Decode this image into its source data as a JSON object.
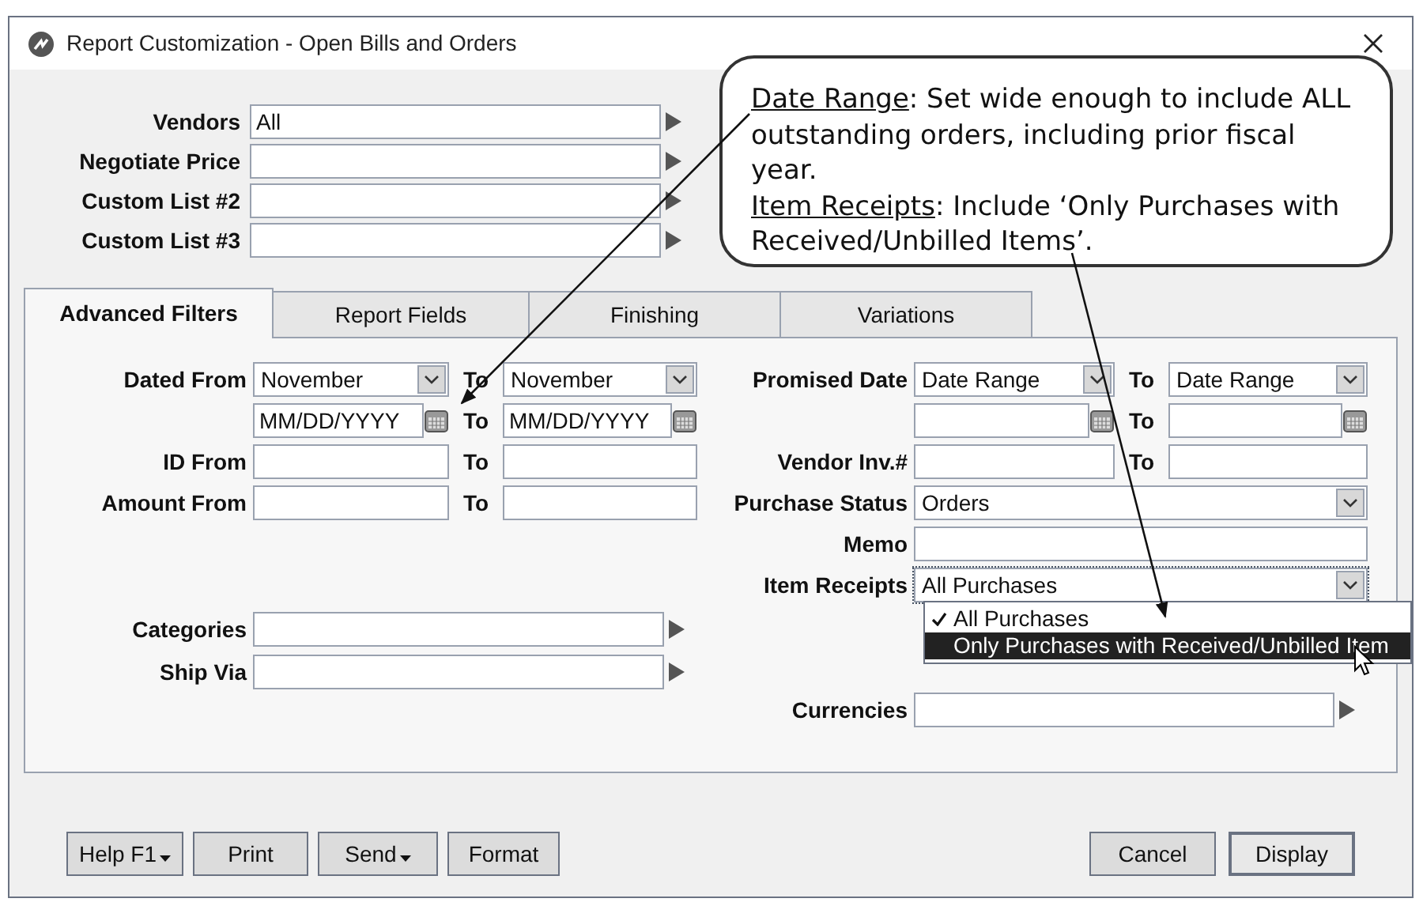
{
  "window": {
    "title": "Report Customization - Open Bills and Orders"
  },
  "top_fields": [
    {
      "label": "Vendors",
      "value": "All"
    },
    {
      "label": "Negotiate Price"
    },
    {
      "label": "Custom List #2"
    },
    {
      "label": "Custom List #3"
    }
  ],
  "tabs": [
    {
      "label": "Advanced Filters",
      "selected": true
    },
    {
      "label": "Report Fields",
      "selected": false
    },
    {
      "label": "Finishing",
      "selected": false
    },
    {
      "label": "Variations",
      "selected": false
    }
  ],
  "left_upper": [
    {
      "kind": "select_range",
      "label": "Dated From",
      "from": "November",
      "to_label": "To",
      "to": "November"
    },
    {
      "kind": "date_range",
      "from": "MM/DD/YYYY",
      "to_label": "To",
      "to": "MM/DD/YYYY"
    },
    {
      "kind": "text_range",
      "label": "ID From",
      "to_label": "To"
    },
    {
      "kind": "text_range",
      "label": "Amount From",
      "to_label": "To"
    }
  ],
  "left_lower": [
    {
      "kind": "list",
      "label": "Categories"
    },
    {
      "kind": "list",
      "label": "Ship Via"
    }
  ],
  "right_upper": [
    {
      "kind": "select_range",
      "label": "Promised Date",
      "from": "Date Range",
      "to_label": "To",
      "to": "Date Range"
    },
    {
      "kind": "date_range",
      "to_label": "To"
    },
    {
      "kind": "text_range",
      "label": "Vendor Inv.#",
      "to_label": "To"
    },
    {
      "kind": "select",
      "label": "Purchase Status",
      "value": "Orders"
    },
    {
      "kind": "text",
      "label": "Memo"
    },
    {
      "kind": "select",
      "label": "Item Receipts",
      "value": "All Purchases",
      "open": true
    }
  ],
  "right_lower": [
    {
      "kind": "list",
      "label": "Currencies"
    }
  ],
  "item_receipts_options": [
    {
      "label": "All Purchases",
      "checked": true,
      "selected": false
    },
    {
      "label": "Only Purchases with Received/Unbilled Item",
      "checked": false,
      "selected": true
    }
  ],
  "callout": [
    {
      "term": "Date Range",
      "text": ": Set wide enough to include ALL outstanding orders, including prior fiscal year."
    },
    {
      "term": "Item Receipts",
      "text": ": Include ‘Only Purchases with Received/Unbilled Items’."
    }
  ],
  "buttons_left": [
    {
      "label": "Help F1",
      "caret": true
    },
    {
      "label": "Print",
      "caret": false
    },
    {
      "label": "Send",
      "caret": true
    },
    {
      "label": "Format",
      "caret": false
    }
  ],
  "buttons_right": [
    {
      "label": "Cancel",
      "default": false
    },
    {
      "label": "Display",
      "default": true
    }
  ]
}
